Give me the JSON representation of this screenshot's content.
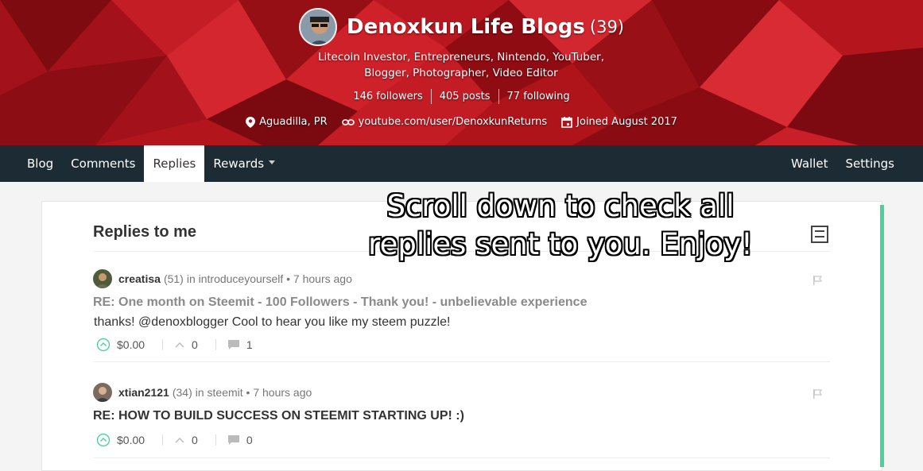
{
  "profile": {
    "name": "Denoxkun Life Blogs",
    "reputation": "(39)",
    "about": "Litecoin Investor, Entrepreneurs, Nintendo, YouTuber, Blogger, Photographer, Video Editor",
    "followers": "146 followers",
    "posts": "405 posts",
    "following": "77 following",
    "location": "Aguadilla, PR",
    "website": "youtube.com/user/DenoxkunReturns",
    "joined": "Joined August 2017"
  },
  "nav": {
    "tabs": [
      "Blog",
      "Comments",
      "Replies",
      "Rewards"
    ],
    "active": "Replies",
    "right": [
      "Wallet",
      "Settings"
    ]
  },
  "main": {
    "title": "Replies to me",
    "replies": [
      {
        "author": "creatisa",
        "reputation": "(51)",
        "context": "in introduceyourself • 7 hours ago",
        "title": "RE: One month on Steemit - 100 Followers - Thank you! - unbelievable experience",
        "body": "thanks! @denoxblogger Cool to hear you like my steem puzzle!",
        "payout": "$0.00",
        "votes": "0",
        "comments": "1"
      },
      {
        "author": "xtian2121",
        "reputation": "(34)",
        "context": "in steemit • 7 hours ago",
        "title": "RE: HOW TO BUILD SUCCESS ON STEEMIT STARTING UP! :)",
        "body": "",
        "payout": "$0.00",
        "votes": "0",
        "comments": "0"
      }
    ]
  },
  "overlay": {
    "caption": "Scroll down to check all replies sent to you. Enjoy!"
  },
  "colors": {
    "banner": "#9b0f14",
    "nav": "#1d2b35",
    "accent_green": "#4cd0a0",
    "reply1_title": "#8a8a8a",
    "reply2_title": "#333333"
  },
  "icons": [
    "location-icon",
    "link-icon",
    "calendar-icon",
    "flag-icon",
    "upvote-icon",
    "vote-count-icon",
    "comment-icon",
    "layout-toggle-icon"
  ]
}
